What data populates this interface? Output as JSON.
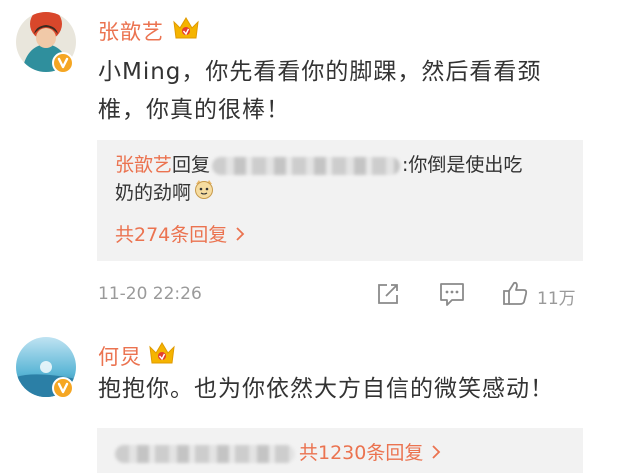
{
  "comments": [
    {
      "username": "张歆艺",
      "text_line1": "小Ming，你先看看你的脚踝，然后看看颈",
      "text_line2": "椎，你真的很棒！",
      "reply": {
        "author": "张歆艺",
        "reply_word": "回复",
        "text_after": ":你倒是使出吃",
        "text_line2": "奶的劲啊",
        "count_label": "共274条回复"
      },
      "timestamp": "11-20 22:26",
      "likes": "11万"
    },
    {
      "username": "何炅",
      "text_line1": "抱抱你。也为你依然大方自信的微笑感动！",
      "reply": {
        "count_label": "共1230条回复"
      }
    }
  ],
  "icons": {
    "crown": "crown-vip-icon",
    "verified": "verified-v-icon",
    "edit": "edit-share-icon",
    "comment": "comment-icon",
    "like": "thumbs-up-icon",
    "chevron": "chevron-right-icon",
    "emoji": "cat-face-emoji-icon"
  },
  "colors": {
    "accent": "#eb7350",
    "verified_badge": "#f5a623",
    "reply_background": "#f2f2f2",
    "meta_gray": "#9a9a9a"
  }
}
